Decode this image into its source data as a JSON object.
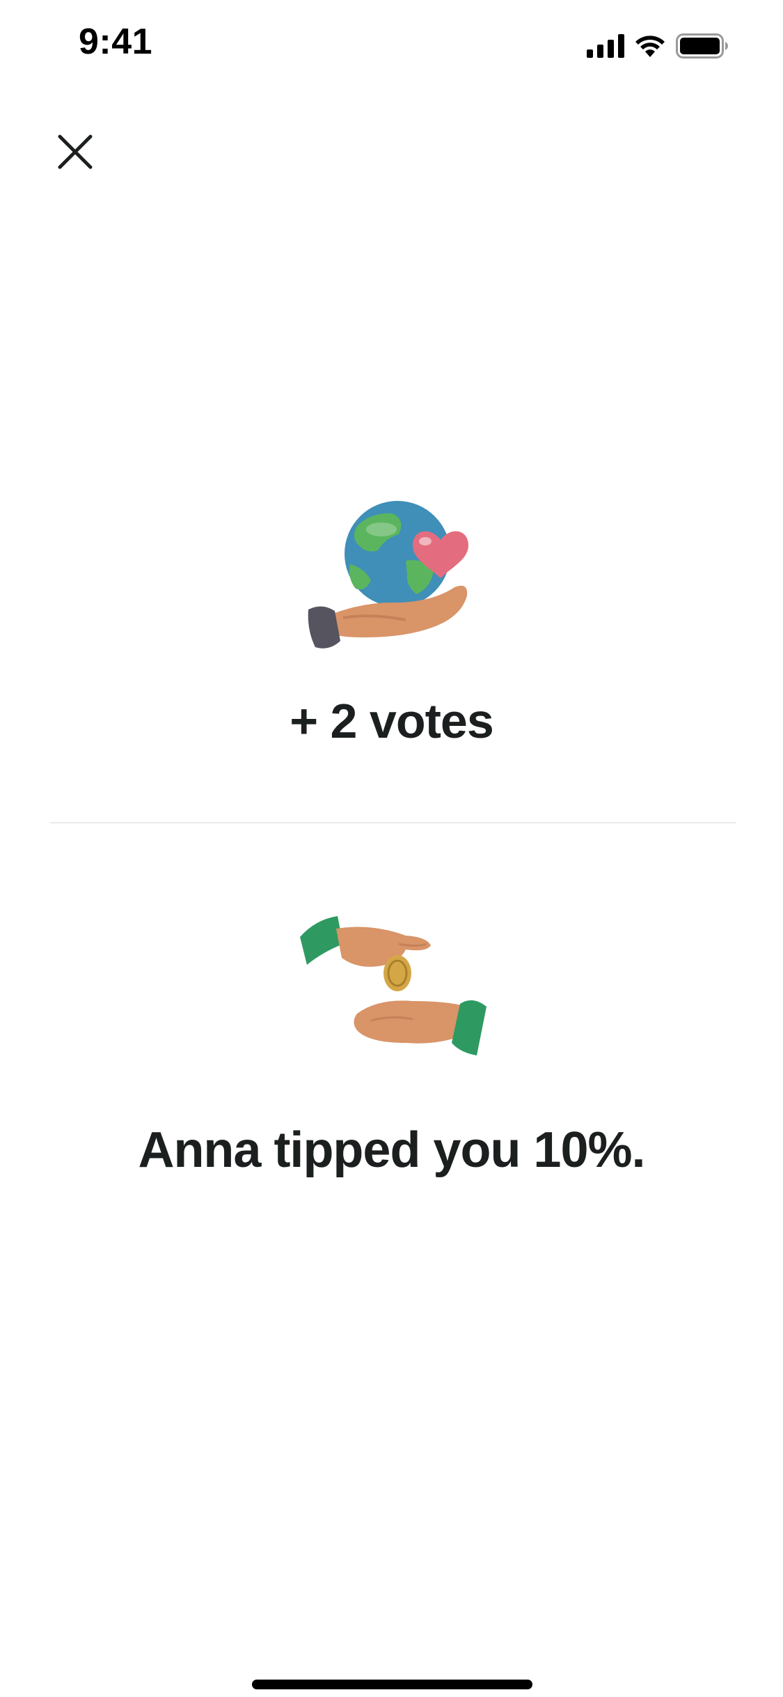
{
  "status_bar": {
    "time": "9:41",
    "signal_icon": "cellular-signal-icon",
    "wifi_icon": "wifi-icon",
    "battery_icon": "battery-icon"
  },
  "header": {
    "close_icon": "close-icon"
  },
  "votes": {
    "illustration": "globe-in-hand-heart-icon",
    "text": "+ 2 votes"
  },
  "tip": {
    "illustration": "hands-passing-coin-icon",
    "text": "Anna tipped you 10%."
  },
  "colors": {
    "text": "#1c1f1f",
    "divider": "#e9eaea",
    "sleeve_green": "#2e9a62",
    "skin": "#d99468",
    "globe_blue": "#3f8fb8",
    "globe_green": "#5bb55e",
    "heart_pink": "#e36d7e",
    "coin_gold": "#d4a646"
  }
}
